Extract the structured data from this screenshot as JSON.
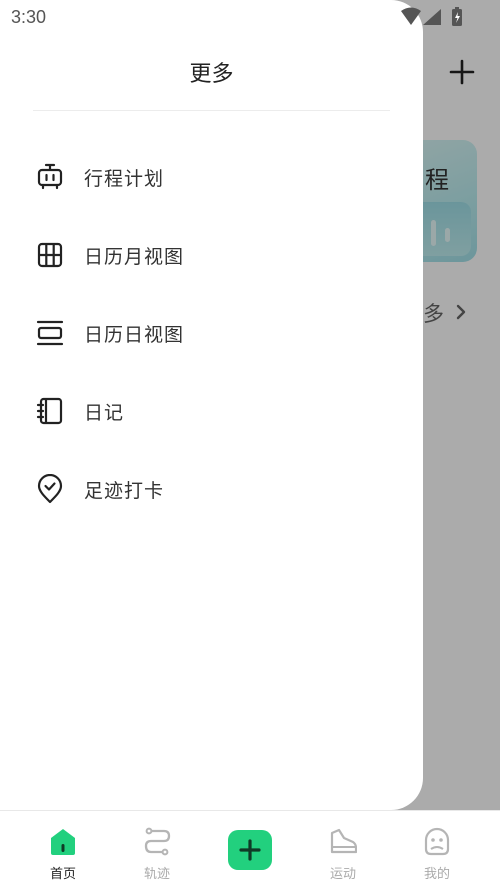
{
  "status_bar": {
    "time": "3:30"
  },
  "drawer": {
    "title": "更多",
    "items": [
      {
        "label": "行程计划",
        "icon": "suitcase-icon"
      },
      {
        "label": "日历月视图",
        "icon": "calendar-grid-icon"
      },
      {
        "label": "日历日视图",
        "icon": "calendar-day-icon"
      },
      {
        "label": "日记",
        "icon": "notebook-icon"
      },
      {
        "label": "足迹打卡",
        "icon": "location-check-icon"
      }
    ]
  },
  "background": {
    "card_title": "行程",
    "more_label": "多"
  },
  "bottom_nav": {
    "items": [
      {
        "label": "首页",
        "icon": "home-icon",
        "active": true
      },
      {
        "label": "轨迹",
        "icon": "route-icon",
        "active": false
      },
      {
        "label": "",
        "icon": "plus-icon",
        "active": false
      },
      {
        "label": "运动",
        "icon": "shoe-icon",
        "active": false
      },
      {
        "label": "我的",
        "icon": "profile-icon",
        "active": false
      }
    ]
  },
  "colors": {
    "accent": "#22d07e",
    "scrim": "rgba(0,0,0,0.33)"
  }
}
